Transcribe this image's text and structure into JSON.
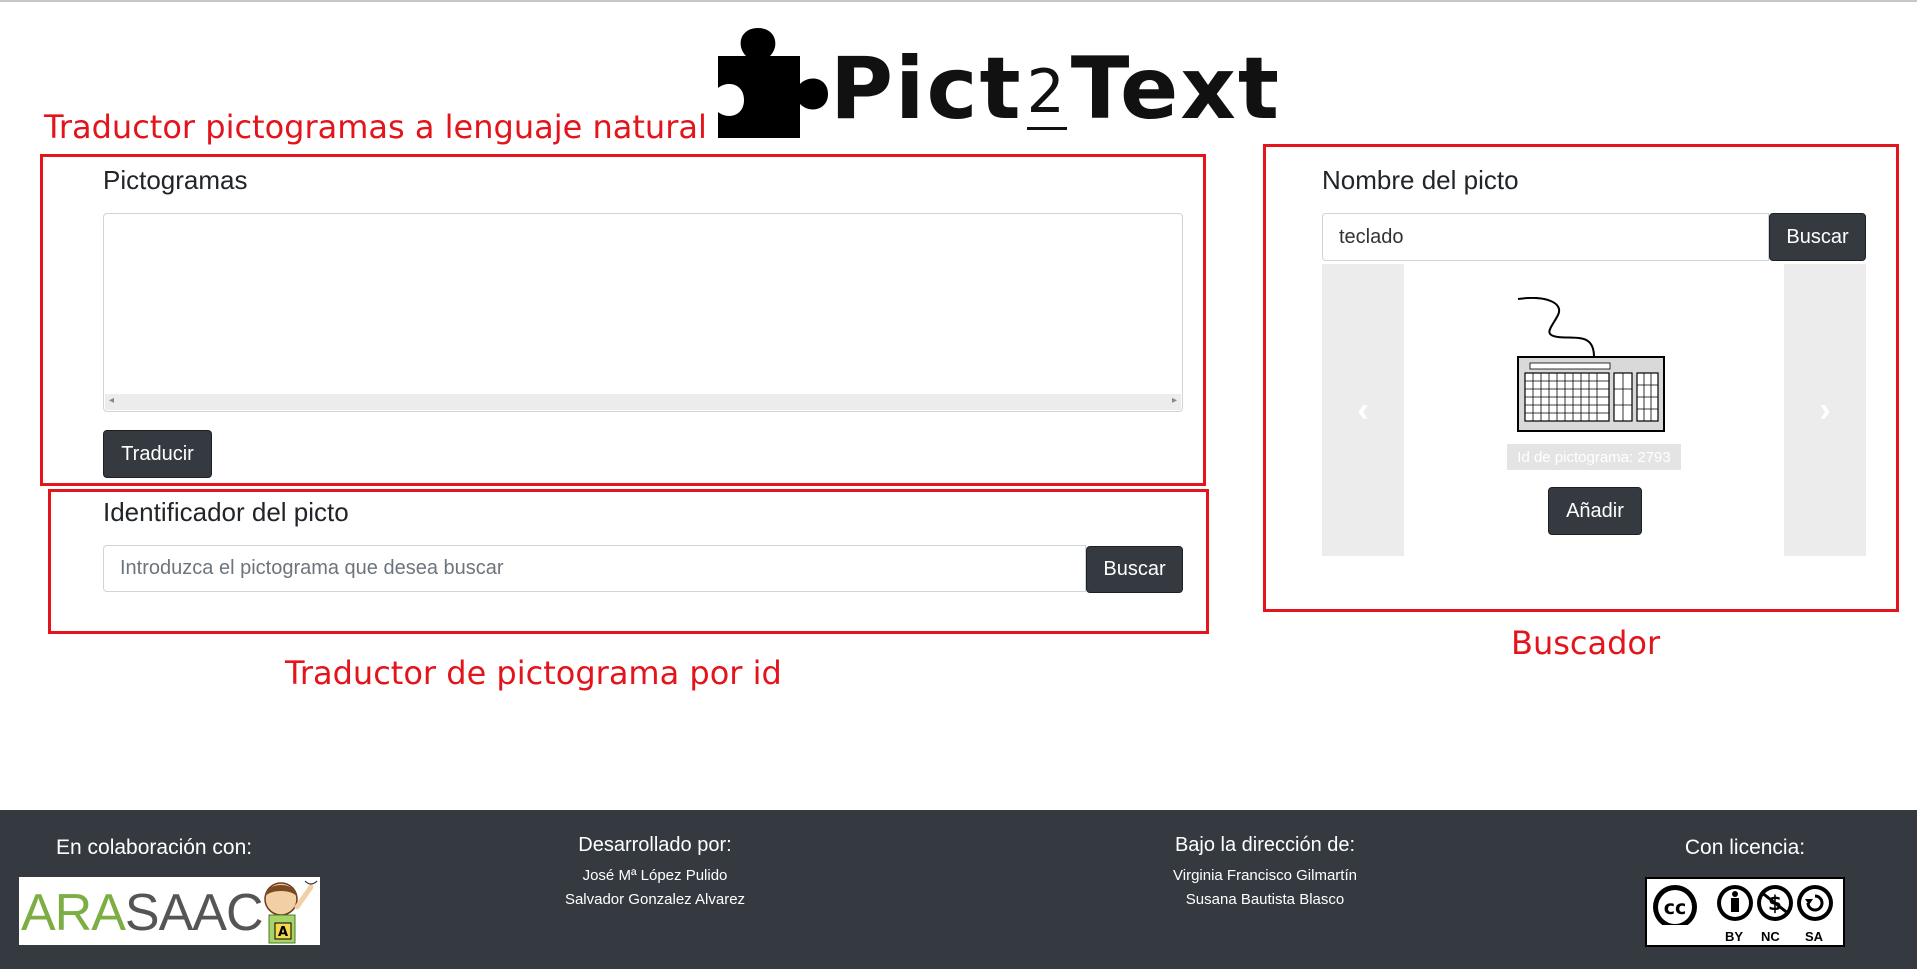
{
  "logo": {
    "text_before": "Pict",
    "text_two": "2",
    "text_after": "Text"
  },
  "annotations": {
    "translator_label": "Traductor pictogramas a lenguaje natural",
    "id_label": "Traductor de pictograma por id",
    "search_label": "Buscador"
  },
  "translator": {
    "title": "Pictogramas",
    "textarea_value": "",
    "translate_button": "Traducir"
  },
  "id_search": {
    "title": "Identificador del picto",
    "placeholder": "Introduzca el pictograma que desea buscar",
    "button": "Buscar"
  },
  "name_search": {
    "title": "Nombre del picto",
    "value": "teclado",
    "button": "Buscar",
    "carousel": {
      "prev_icon": "chevron-left",
      "next_icon": "chevron-right",
      "pictogram_icon": "keyboard",
      "id_caption": "Id de pictograma: 2793",
      "add_button": "Añadir"
    }
  },
  "footer": {
    "collab": {
      "heading": "En colaboración con:",
      "logo_a": "ARA",
      "logo_b": "SAAC",
      "badge": "A"
    },
    "dev": {
      "heading": "Desarrollado por:",
      "names": [
        "José Mª López Pulido",
        "Salvador Gonzalez Alvarez"
      ]
    },
    "direction": {
      "heading": "Bajo la dirección de:",
      "names": [
        "Virginia Francisco Gilmartín",
        "Susana Bautista Blasco"
      ]
    },
    "license": {
      "heading": "Con licencia:",
      "badge_cc": "cc",
      "labels": [
        "BY",
        "NC",
        "SA"
      ]
    }
  },
  "colors": {
    "annotation_red": "#e3141b",
    "dark": "#343a40",
    "arasaac_green": "#7cae44"
  }
}
